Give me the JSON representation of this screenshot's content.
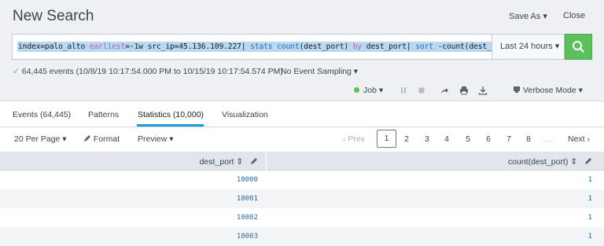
{
  "header": {
    "title": "New Search",
    "save_as": "Save As ▾",
    "close": "Close"
  },
  "search": {
    "query_parts": [
      {
        "text": "index=palo_alto ",
        "kind": "plain"
      },
      {
        "text": "earliest",
        "kind": "kw"
      },
      {
        "text": "=-1w src_ip=45.136.109.227| ",
        "kind": "plain"
      },
      {
        "text": "stats count",
        "kind": "cmd"
      },
      {
        "text": "(dest_port) ",
        "kind": "plain"
      },
      {
        "text": "by",
        "kind": "kw"
      },
      {
        "text": " dest_port| ",
        "kind": "plain"
      },
      {
        "text": "sort",
        "kind": "cmd"
      },
      {
        "text": " -count(dest_port)",
        "kind": "plain"
      }
    ],
    "time_range": "Last 24 hours ▾",
    "button_icon": "search-icon",
    "button_color": "#5cc05c"
  },
  "status": {
    "events_text": "64,445 events (10/8/19 10:17:54.000 PM to 10/15/19 10:17:54.574 PM)",
    "sampling": "No Event Sampling ▾"
  },
  "job": {
    "label": "Job ▾",
    "verbose_mode": "Verbose Mode ▾",
    "controls": [
      "pause-icon",
      "stop-icon",
      "share-icon",
      "print-icon",
      "export-icon"
    ]
  },
  "tabs": [
    {
      "label": "Events (64,445)",
      "active": false
    },
    {
      "label": "Patterns",
      "active": false
    },
    {
      "label": "Statistics (10,000)",
      "active": true
    },
    {
      "label": "Visualization",
      "active": false
    }
  ],
  "toolbar": {
    "per_page": "20 Per Page ▾",
    "format": "Format",
    "preview": "Preview ▾"
  },
  "pagination": {
    "prev": "‹ Prev",
    "pages": [
      "1",
      "2",
      "3",
      "4",
      "5",
      "6",
      "7",
      "8"
    ],
    "ellipsis": "...",
    "next": "Next ›",
    "current": "1"
  },
  "table": {
    "columns": [
      {
        "label": "dest_port ⇕"
      },
      {
        "label": "count(dest_port) ⇕"
      }
    ],
    "rows": [
      {
        "dest_port": "10000",
        "count": "1"
      },
      {
        "dest_port": "10001",
        "count": "1"
      },
      {
        "dest_port": "10002",
        "count": "1"
      },
      {
        "dest_port": "10003",
        "count": "1"
      }
    ]
  },
  "colors": {
    "accent_blue": "#1a9cd8",
    "success_green": "#5cc05c",
    "link_blue": "#2968a8"
  }
}
